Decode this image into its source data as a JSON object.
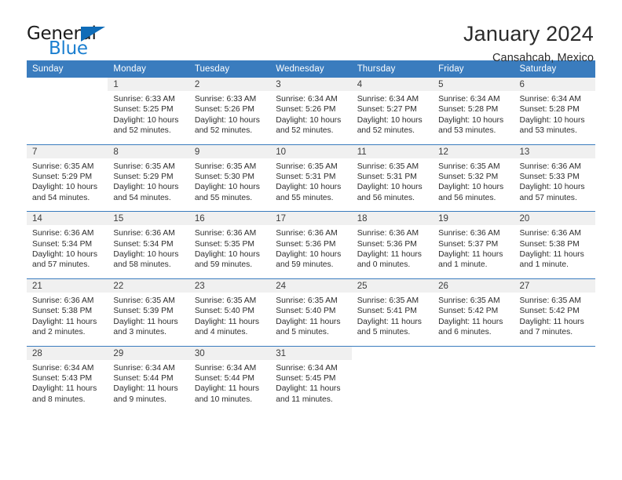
{
  "brand": {
    "word_one": "General",
    "word_two": "Blue",
    "triangle_icon": "triangle-icon",
    "accent_color": "#1b7fd0",
    "header_color": "#3a7cbe"
  },
  "header": {
    "title": "January 2024",
    "subtitle": "Cansahcab, Mexico"
  },
  "calendar": {
    "weekdays": [
      "Sunday",
      "Monday",
      "Tuesday",
      "Wednesday",
      "Thursday",
      "Friday",
      "Saturday"
    ],
    "labels": {
      "sunrise": "Sunrise:",
      "sunset": "Sunset:",
      "daylight": "Daylight:"
    },
    "weeks": [
      [
        {
          "day": "",
          "sunrise": "",
          "sunset": "",
          "daylight": ""
        },
        {
          "day": "1",
          "sunrise": "Sunrise: 6:33 AM",
          "sunset": "Sunset: 5:25 PM",
          "daylight": "Daylight: 10 hours and 52 minutes."
        },
        {
          "day": "2",
          "sunrise": "Sunrise: 6:33 AM",
          "sunset": "Sunset: 5:26 PM",
          "daylight": "Daylight: 10 hours and 52 minutes."
        },
        {
          "day": "3",
          "sunrise": "Sunrise: 6:34 AM",
          "sunset": "Sunset: 5:26 PM",
          "daylight": "Daylight: 10 hours and 52 minutes."
        },
        {
          "day": "4",
          "sunrise": "Sunrise: 6:34 AM",
          "sunset": "Sunset: 5:27 PM",
          "daylight": "Daylight: 10 hours and 52 minutes."
        },
        {
          "day": "5",
          "sunrise": "Sunrise: 6:34 AM",
          "sunset": "Sunset: 5:28 PM",
          "daylight": "Daylight: 10 hours and 53 minutes."
        },
        {
          "day": "6",
          "sunrise": "Sunrise: 6:34 AM",
          "sunset": "Sunset: 5:28 PM",
          "daylight": "Daylight: 10 hours and 53 minutes."
        }
      ],
      [
        {
          "day": "7",
          "sunrise": "Sunrise: 6:35 AM",
          "sunset": "Sunset: 5:29 PM",
          "daylight": "Daylight: 10 hours and 54 minutes."
        },
        {
          "day": "8",
          "sunrise": "Sunrise: 6:35 AM",
          "sunset": "Sunset: 5:29 PM",
          "daylight": "Daylight: 10 hours and 54 minutes."
        },
        {
          "day": "9",
          "sunrise": "Sunrise: 6:35 AM",
          "sunset": "Sunset: 5:30 PM",
          "daylight": "Daylight: 10 hours and 55 minutes."
        },
        {
          "day": "10",
          "sunrise": "Sunrise: 6:35 AM",
          "sunset": "Sunset: 5:31 PM",
          "daylight": "Daylight: 10 hours and 55 minutes."
        },
        {
          "day": "11",
          "sunrise": "Sunrise: 6:35 AM",
          "sunset": "Sunset: 5:31 PM",
          "daylight": "Daylight: 10 hours and 56 minutes."
        },
        {
          "day": "12",
          "sunrise": "Sunrise: 6:35 AM",
          "sunset": "Sunset: 5:32 PM",
          "daylight": "Daylight: 10 hours and 56 minutes."
        },
        {
          "day": "13",
          "sunrise": "Sunrise: 6:36 AM",
          "sunset": "Sunset: 5:33 PM",
          "daylight": "Daylight: 10 hours and 57 minutes."
        }
      ],
      [
        {
          "day": "14",
          "sunrise": "Sunrise: 6:36 AM",
          "sunset": "Sunset: 5:34 PM",
          "daylight": "Daylight: 10 hours and 57 minutes."
        },
        {
          "day": "15",
          "sunrise": "Sunrise: 6:36 AM",
          "sunset": "Sunset: 5:34 PM",
          "daylight": "Daylight: 10 hours and 58 minutes."
        },
        {
          "day": "16",
          "sunrise": "Sunrise: 6:36 AM",
          "sunset": "Sunset: 5:35 PM",
          "daylight": "Daylight: 10 hours and 59 minutes."
        },
        {
          "day": "17",
          "sunrise": "Sunrise: 6:36 AM",
          "sunset": "Sunset: 5:36 PM",
          "daylight": "Daylight: 10 hours and 59 minutes."
        },
        {
          "day": "18",
          "sunrise": "Sunrise: 6:36 AM",
          "sunset": "Sunset: 5:36 PM",
          "daylight": "Daylight: 11 hours and 0 minutes."
        },
        {
          "day": "19",
          "sunrise": "Sunrise: 6:36 AM",
          "sunset": "Sunset: 5:37 PM",
          "daylight": "Daylight: 11 hours and 1 minute."
        },
        {
          "day": "20",
          "sunrise": "Sunrise: 6:36 AM",
          "sunset": "Sunset: 5:38 PM",
          "daylight": "Daylight: 11 hours and 1 minute."
        }
      ],
      [
        {
          "day": "21",
          "sunrise": "Sunrise: 6:36 AM",
          "sunset": "Sunset: 5:38 PM",
          "daylight": "Daylight: 11 hours and 2 minutes."
        },
        {
          "day": "22",
          "sunrise": "Sunrise: 6:35 AM",
          "sunset": "Sunset: 5:39 PM",
          "daylight": "Daylight: 11 hours and 3 minutes."
        },
        {
          "day": "23",
          "sunrise": "Sunrise: 6:35 AM",
          "sunset": "Sunset: 5:40 PM",
          "daylight": "Daylight: 11 hours and 4 minutes."
        },
        {
          "day": "24",
          "sunrise": "Sunrise: 6:35 AM",
          "sunset": "Sunset: 5:40 PM",
          "daylight": "Daylight: 11 hours and 5 minutes."
        },
        {
          "day": "25",
          "sunrise": "Sunrise: 6:35 AM",
          "sunset": "Sunset: 5:41 PM",
          "daylight": "Daylight: 11 hours and 5 minutes."
        },
        {
          "day": "26",
          "sunrise": "Sunrise: 6:35 AM",
          "sunset": "Sunset: 5:42 PM",
          "daylight": "Daylight: 11 hours and 6 minutes."
        },
        {
          "day": "27",
          "sunrise": "Sunrise: 6:35 AM",
          "sunset": "Sunset: 5:42 PM",
          "daylight": "Daylight: 11 hours and 7 minutes."
        }
      ],
      [
        {
          "day": "28",
          "sunrise": "Sunrise: 6:34 AM",
          "sunset": "Sunset: 5:43 PM",
          "daylight": "Daylight: 11 hours and 8 minutes."
        },
        {
          "day": "29",
          "sunrise": "Sunrise: 6:34 AM",
          "sunset": "Sunset: 5:44 PM",
          "daylight": "Daylight: 11 hours and 9 minutes."
        },
        {
          "day": "30",
          "sunrise": "Sunrise: 6:34 AM",
          "sunset": "Sunset: 5:44 PM",
          "daylight": "Daylight: 11 hours and 10 minutes."
        },
        {
          "day": "31",
          "sunrise": "Sunrise: 6:34 AM",
          "sunset": "Sunset: 5:45 PM",
          "daylight": "Daylight: 11 hours and 11 minutes."
        },
        {
          "day": "",
          "sunrise": "",
          "sunset": "",
          "daylight": ""
        },
        {
          "day": "",
          "sunrise": "",
          "sunset": "",
          "daylight": ""
        },
        {
          "day": "",
          "sunrise": "",
          "sunset": "",
          "daylight": ""
        }
      ]
    ]
  }
}
